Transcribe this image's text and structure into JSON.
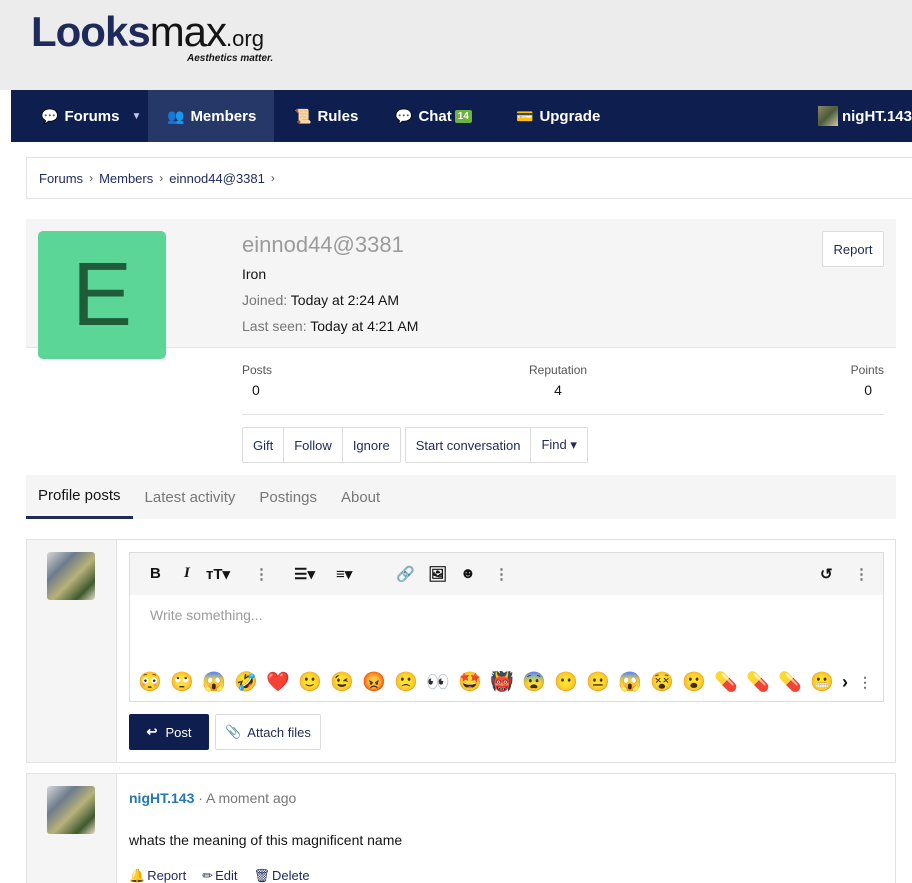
{
  "header": {
    "logo": {
      "part1": "Looks",
      "part2": "max",
      "tld": ".org",
      "tagline": "Aesthetics matter."
    }
  },
  "nav": {
    "items": [
      {
        "label": "Forums",
        "icon": "comments-icon"
      },
      {
        "label": "Members",
        "icon": "users-icon"
      },
      {
        "label": "Rules",
        "icon": "scroll-icon"
      },
      {
        "label": "Chat",
        "icon": "chat-icon",
        "badge": "14"
      },
      {
        "label": "Upgrade",
        "icon": "credit-card-icon"
      }
    ],
    "user": "nigHT.143"
  },
  "breadcrumb": [
    "Forums",
    "Members",
    "einnod44@3381"
  ],
  "profile": {
    "avatar_letter": "E",
    "avatar_color": "#5cd696",
    "username": "einnod44@3381",
    "rank": "Iron",
    "joined_label": "Joined:",
    "joined_value": "Today at 2:24 AM",
    "last_seen_label": "Last seen:",
    "last_seen_value": "Today at 4:21 AM",
    "report_label": "Report",
    "stats": [
      {
        "label": "Posts",
        "value": "0"
      },
      {
        "label": "Reputation",
        "value": "4"
      },
      {
        "label": "Points",
        "value": "0"
      }
    ],
    "actions": [
      "Gift",
      "Follow",
      "Ignore"
    ],
    "conversation_actions": [
      "Start conversation",
      "Find ▾"
    ]
  },
  "tabs": [
    "Profile posts",
    "Latest activity",
    "Postings",
    "About"
  ],
  "composer": {
    "placeholder": "Write something...",
    "post_label": "Post",
    "attach_label": "Attach files",
    "smilies": [
      "😳",
      "🙄",
      "😱",
      "🤣",
      "❤️",
      "🙂",
      "😉",
      "😡",
      "🙁",
      "👀",
      "🤩",
      "👹",
      "😨",
      "😶",
      "😐",
      "😱",
      "😵",
      "😮",
      "💊",
      "💊",
      "💊",
      "😬"
    ]
  },
  "message": {
    "user": "nigHT.143",
    "time": " · A moment ago",
    "body": "whats the meaning of this magnificent name",
    "actions": [
      "Report",
      "Edit",
      "Delete"
    ]
  },
  "colors": {
    "nav_bg": "#0e1f4f",
    "link": "#2577b1",
    "avatar_bg": "#5cd696"
  }
}
